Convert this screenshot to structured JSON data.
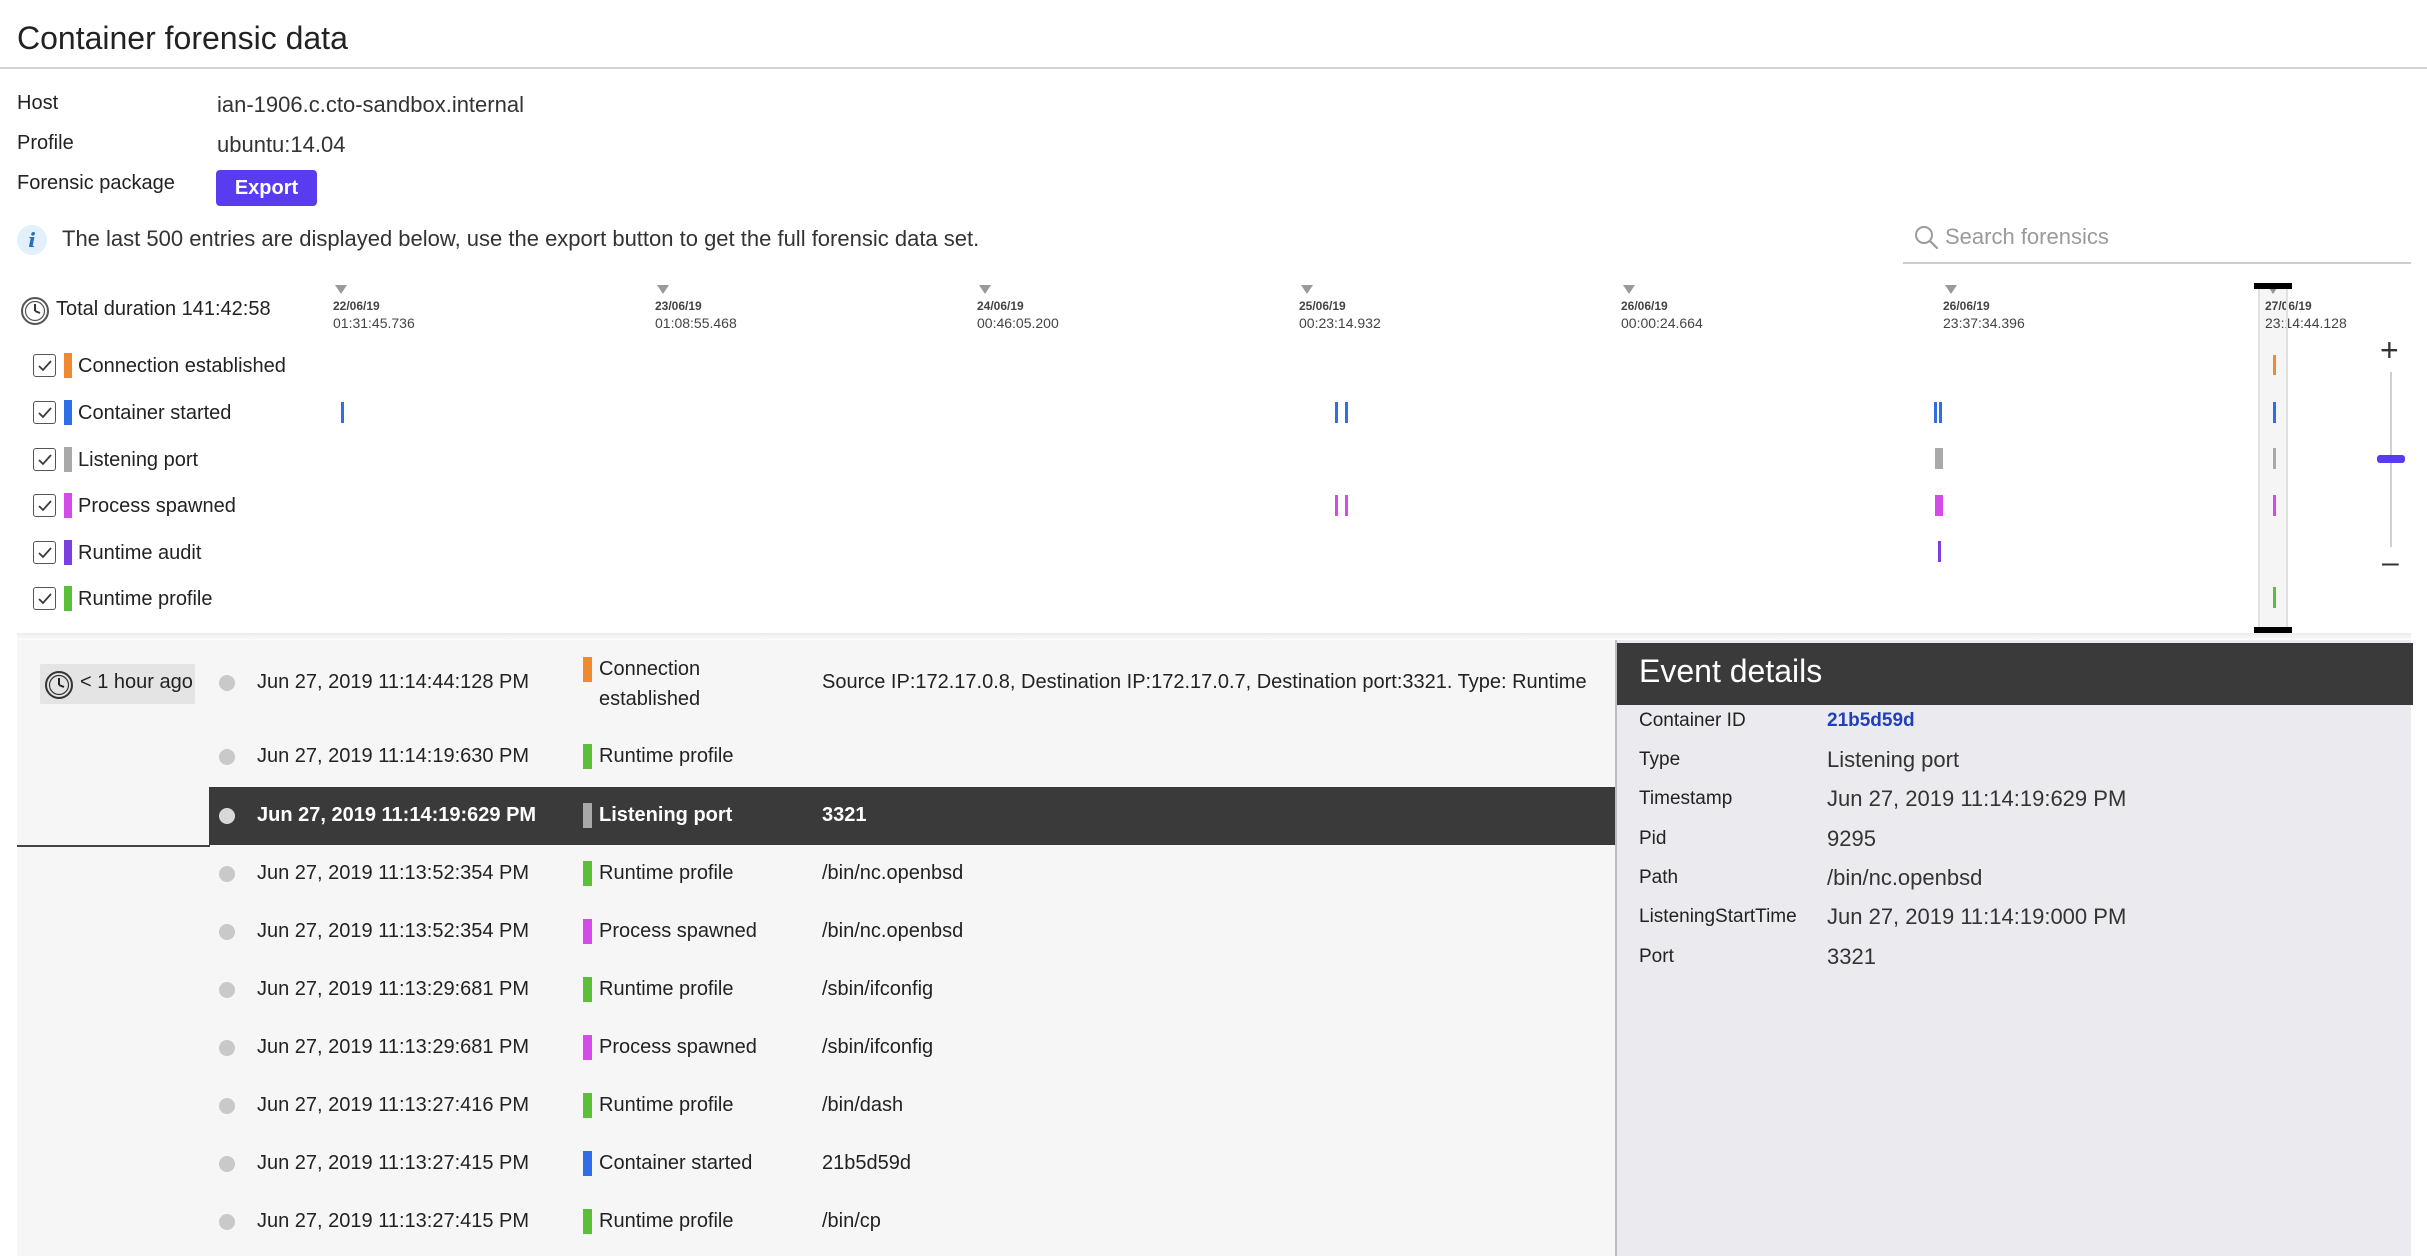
{
  "page": {
    "title": "Container forensic data"
  },
  "meta": {
    "host_label": "Host",
    "host_value": "ian-1906.c.cto-sandbox.internal",
    "profile_label": "Profile",
    "profile_value": "ubuntu:14.04",
    "package_label": "Forensic package",
    "export_label": "Export"
  },
  "info": {
    "text": "The last 500 entries are displayed below, use the export button to get the full forensic data set."
  },
  "search": {
    "placeholder": "Search forensics"
  },
  "timeline": {
    "total_duration": "Total duration 141:42:58",
    "ticks": [
      {
        "date": "22/06/19",
        "time": "01:31:45.736"
      },
      {
        "date": "23/06/19",
        "time": "01:08:55.468"
      },
      {
        "date": "24/06/19",
        "time": "00:46:05.200"
      },
      {
        "date": "25/06/19",
        "time": "00:23:14.932"
      },
      {
        "date": "26/06/19",
        "time": "00:00:24.664"
      },
      {
        "date": "26/06/19",
        "time": "23:37:34.396"
      },
      {
        "date": "27/06/19",
        "time": "23:14:44.128"
      }
    ],
    "legend": [
      {
        "label": "Connection established",
        "color": "#f08a32",
        "checked": true
      },
      {
        "label": "Container started",
        "color": "#2f6ee8",
        "checked": true
      },
      {
        "label": "Listening port",
        "color": "#a9a9a9",
        "checked": true
      },
      {
        "label": "Process spawned",
        "color": "#d44be8",
        "checked": true
      },
      {
        "label": "Runtime audit",
        "color": "#7b3fe0",
        "checked": true
      },
      {
        "label": "Runtime profile",
        "color": "#5bbf3a",
        "checked": true
      }
    ],
    "zoom": {
      "plus": "+",
      "minus": "–"
    }
  },
  "events": {
    "group_label": "< 1 hour ago",
    "rows": [
      {
        "time": "Jun 27, 2019 11:14:44:128 PM",
        "type": "Connection established",
        "color": "#f08a32",
        "detail": "Source IP:172.17.0.8, Destination IP:172.17.0.7, Destination port:3321. Type: Runtime",
        "selected": false
      },
      {
        "time": "Jun 27, 2019 11:14:19:630 PM",
        "type": "Runtime profile",
        "color": "#5bbf3a",
        "detail": "",
        "selected": false
      },
      {
        "time": "Jun 27, 2019 11:14:19:629 PM",
        "type": "Listening port",
        "color": "#a9a9a9",
        "detail": "3321",
        "selected": true
      },
      {
        "time": "Jun 27, 2019 11:13:52:354 PM",
        "type": "Runtime profile",
        "color": "#5bbf3a",
        "detail": "/bin/nc.openbsd",
        "selected": false
      },
      {
        "time": "Jun 27, 2019 11:13:52:354 PM",
        "type": "Process spawned",
        "color": "#d44be8",
        "detail": "/bin/nc.openbsd",
        "selected": false
      },
      {
        "time": "Jun 27, 2019 11:13:29:681 PM",
        "type": "Runtime profile",
        "color": "#5bbf3a",
        "detail": "/sbin/ifconfig",
        "selected": false
      },
      {
        "time": "Jun 27, 2019 11:13:29:681 PM",
        "type": "Process spawned",
        "color": "#d44be8",
        "detail": "/sbin/ifconfig",
        "selected": false
      },
      {
        "time": "Jun 27, 2019 11:13:27:416 PM",
        "type": "Runtime profile",
        "color": "#5bbf3a",
        "detail": "/bin/dash",
        "selected": false
      },
      {
        "time": "Jun 27, 2019 11:13:27:415 PM",
        "type": "Container started",
        "color": "#2f6ee8",
        "detail": "21b5d59d",
        "selected": false
      },
      {
        "time": "Jun 27, 2019 11:13:27:415 PM",
        "type": "Runtime profile",
        "color": "#5bbf3a",
        "detail": "/bin/cp",
        "selected": false
      }
    ]
  },
  "details": {
    "title": "Event details",
    "fields": [
      {
        "label": "Container ID",
        "value": "21b5d59d"
      },
      {
        "label": "Type",
        "value": "Listening port"
      },
      {
        "label": "Timestamp",
        "value": "Jun 27, 2019 11:14:19:629 PM"
      },
      {
        "label": "Pid",
        "value": "9295"
      },
      {
        "label": "Path",
        "value": "/bin/nc.openbsd"
      },
      {
        "label": "ListeningStartTime",
        "value": "Jun 27, 2019 11:14:19:000 PM"
      },
      {
        "label": "Port",
        "value": "3321"
      }
    ]
  }
}
